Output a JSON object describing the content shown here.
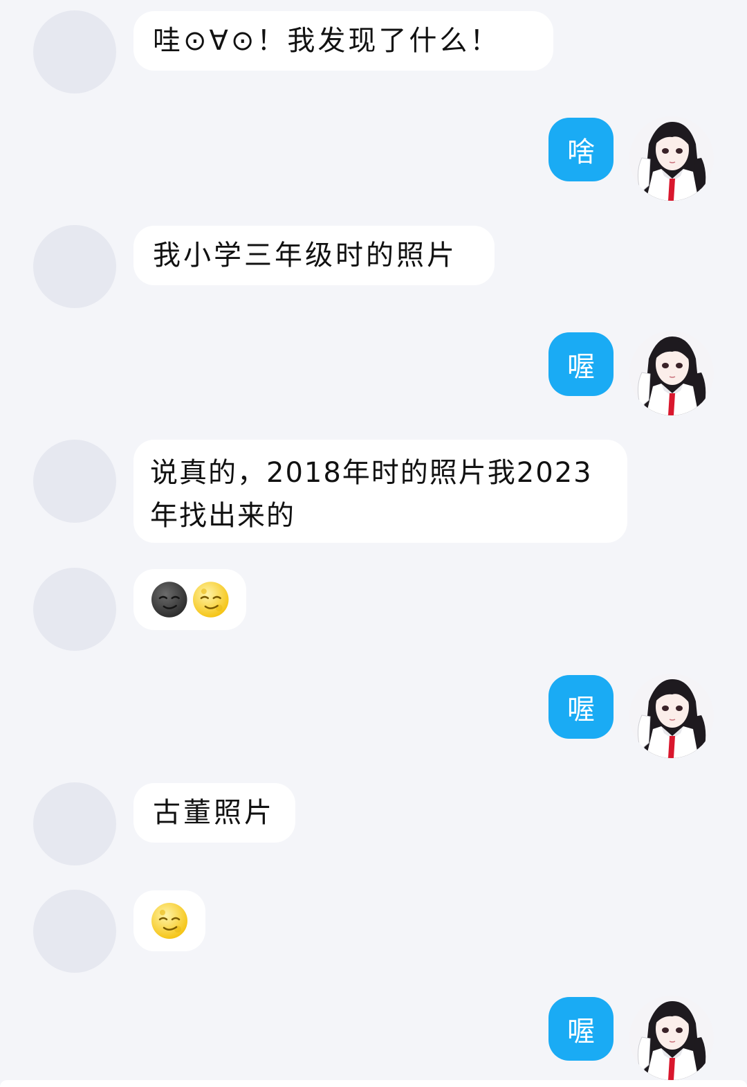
{
  "messages": [
    {
      "side": "in",
      "text": "哇⊙∀⊙！我发现了什么！"
    },
    {
      "side": "out",
      "text": "啥"
    },
    {
      "side": "in",
      "text": "我小学三年级时的照片"
    },
    {
      "side": "out",
      "text": "喔"
    },
    {
      "side": "in",
      "text": "说真的，2018年时的照片我2023年找出来的"
    },
    {
      "side": "in",
      "type": "emoji",
      "icons": [
        "new-moon-face-icon",
        "full-moon-face-icon"
      ]
    },
    {
      "side": "out",
      "text": "喔"
    },
    {
      "side": "in",
      "text": "古董照片"
    },
    {
      "side": "in",
      "type": "emoji",
      "icons": [
        "full-moon-face-icon"
      ]
    },
    {
      "side": "out",
      "text": "喔"
    }
  ],
  "colors": {
    "background": "#f4f5f9",
    "incoming_bubble": "#ffffff",
    "outgoing_bubble": "#1aabf4",
    "placeholder_avatar": "#e6e8f0"
  }
}
